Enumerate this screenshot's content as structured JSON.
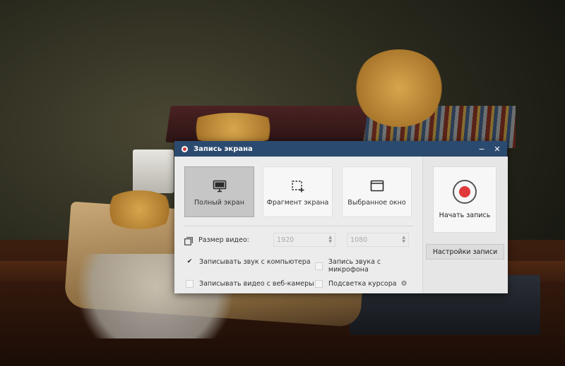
{
  "window": {
    "title": "Запись экрана",
    "minimize_glyph": "−",
    "close_glyph": "✕"
  },
  "modes": [
    {
      "label": "Полный экран",
      "icon": "monitor-icon",
      "selected": true
    },
    {
      "label": "Фрагмент экрана",
      "icon": "crop-area-icon",
      "selected": false
    },
    {
      "label": "Выбранное окно",
      "icon": "window-icon",
      "selected": false
    }
  ],
  "video_size": {
    "label": "Размер видео:",
    "width": "1920",
    "height": "1080"
  },
  "options": {
    "system_audio": {
      "label": "Записывать звук с компьютера",
      "checked": true
    },
    "mic_audio": {
      "label": "Запись звука с микрофона",
      "checked": false
    },
    "webcam": {
      "label": "Записывать видео с веб-камеры",
      "checked": false
    },
    "cursor_highlight": {
      "label": "Подсветка курсора",
      "checked": false
    }
  },
  "record": {
    "label": "Начать запись",
    "accent": "#e0393b"
  },
  "settings_button": "Настройки записи",
  "colors": {
    "titlebar": "#2b4a6f",
    "selected_mode": "#c6c6c6"
  },
  "check_glyph": "✔"
}
